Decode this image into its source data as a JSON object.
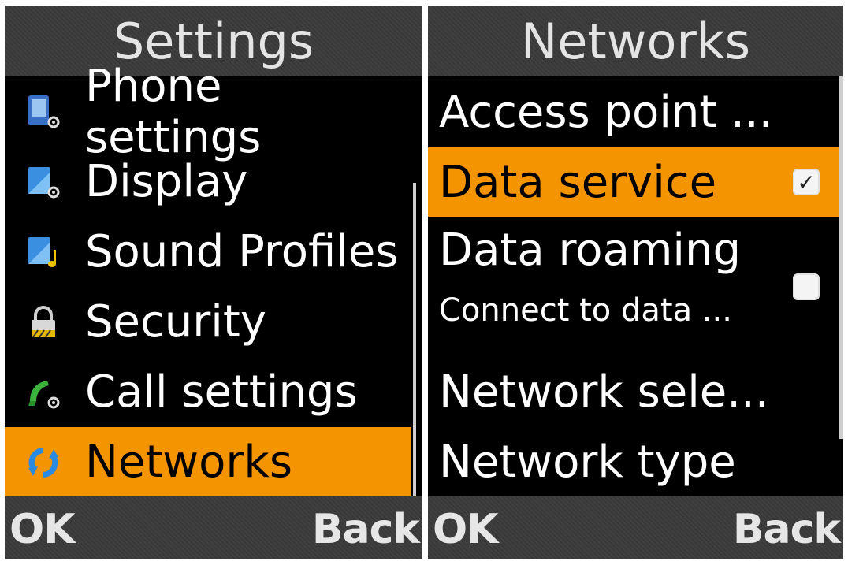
{
  "left_screen": {
    "title": "Settings",
    "items": [
      {
        "label": "Phone settings",
        "icon": "phone-settings-icon"
      },
      {
        "label": "Display",
        "icon": "display-settings-icon"
      },
      {
        "label": "Sound Profiles",
        "icon": "sound-profiles-icon"
      },
      {
        "label": "Security",
        "icon": "lock-icon"
      },
      {
        "label": "Call settings",
        "icon": "call-settings-icon"
      },
      {
        "label": "Networks",
        "icon": "networks-icon",
        "selected": true
      }
    ],
    "softkeys": {
      "left": "OK",
      "right": "Back"
    }
  },
  "right_screen": {
    "title": "Networks",
    "items": [
      {
        "label": "Access point ..."
      },
      {
        "label": "Data service",
        "checked": true,
        "selected": true
      },
      {
        "label": "Data roaming",
        "sublabel": "Connect to data ...",
        "checked": false
      },
      {
        "label": "Network sele..."
      },
      {
        "label": "Network type"
      }
    ],
    "softkeys": {
      "left": "OK",
      "right": "Back"
    }
  },
  "colors": {
    "highlight": "#f39400",
    "bar": "#3a3a3a",
    "background": "#000000"
  },
  "glyphs": {
    "check": "✓"
  }
}
